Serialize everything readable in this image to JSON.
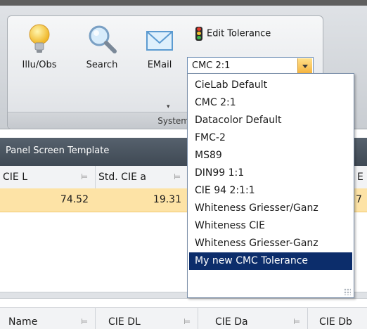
{
  "ribbon": {
    "buttons": [
      {
        "label": "Illu/Obs",
        "icon": "lightbulb-icon"
      },
      {
        "label": "Search",
        "icon": "magnifier-icon"
      },
      {
        "label": "EMail",
        "icon": "envelope-icon"
      }
    ],
    "edit_tolerance": "Edit Tolerance",
    "group_label": "System"
  },
  "combo": {
    "value": "CMC 2:1",
    "options": [
      "CieLab Default",
      "CMC 2:1",
      "Datacolor Default",
      "FMC-2",
      "MS89",
      "DIN99 1:1",
      "CIE 94 2:1:1",
      "Whiteness Griesser/Ganz",
      "Whiteness CIE",
      "Whiteness Griesser-Ganz",
      "My new CMC Tolerance"
    ],
    "selected": "My new CMC Tolerance",
    "accent": "#0c2d6b"
  },
  "panel": {
    "title": "Panel Screen Template",
    "columns": [
      "CIE L",
      "Std. CIE a",
      "E"
    ],
    "row": [
      "74.52",
      "19.31",
      "7"
    ],
    "row_color": "#fde3a6"
  },
  "bottom_columns": [
    "Name",
    "CIE DL",
    "CIE Da",
    "CIE Db"
  ]
}
